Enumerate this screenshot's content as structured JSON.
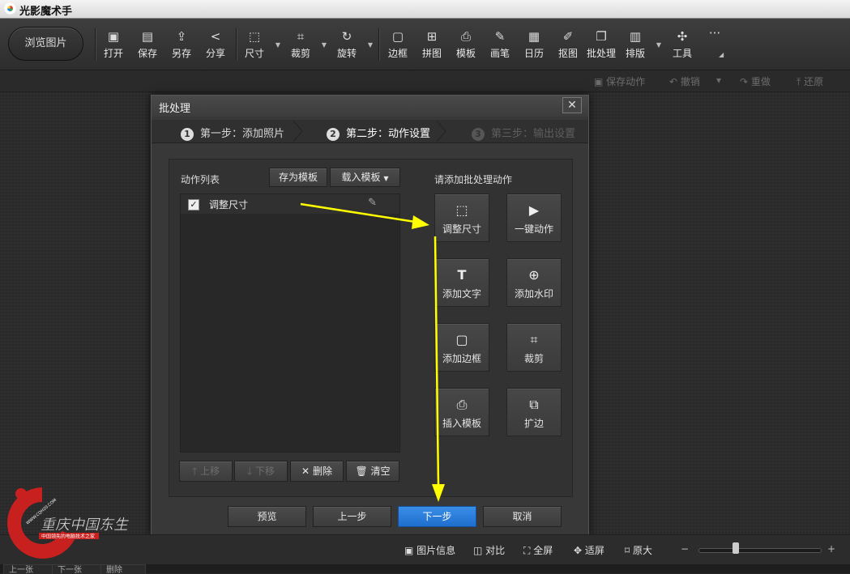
{
  "app": {
    "title": "光影魔术手"
  },
  "toolbar": {
    "browse_label": "浏览图片",
    "tools": [
      {
        "label": "打开",
        "icon": "open-image-icon"
      },
      {
        "label": "保存",
        "icon": "save-icon"
      },
      {
        "label": "另存",
        "icon": "save-as-icon"
      },
      {
        "label": "分享",
        "icon": "share-icon"
      },
      {
        "label": "尺寸",
        "icon": "resize-icon"
      },
      {
        "label": "裁剪",
        "icon": "crop-icon"
      },
      {
        "label": "旋转",
        "icon": "rotate-icon"
      },
      {
        "label": "边框",
        "icon": "border-icon"
      },
      {
        "label": "拼图",
        "icon": "collage-icon"
      },
      {
        "label": "模板",
        "icon": "template-icon"
      },
      {
        "label": "画笔",
        "icon": "brush-icon"
      },
      {
        "label": "日历",
        "icon": "calendar-icon"
      },
      {
        "label": "抠图",
        "icon": "cutout-icon"
      },
      {
        "label": "批处理",
        "icon": "batch-icon"
      },
      {
        "label": "排版",
        "icon": "layout-icon"
      },
      {
        "label": "工具",
        "icon": "wrench-icon"
      }
    ],
    "more": "···"
  },
  "actionbar": {
    "save_action": "保存动作",
    "undo": "撤销",
    "redo": "重做",
    "restore": "还原"
  },
  "dialog": {
    "title": "批处理",
    "close": "✕",
    "steps": [
      {
        "num": "1",
        "label": "第一步：添加照片"
      },
      {
        "num": "2",
        "label": "第二步：动作设置"
      },
      {
        "num": "3",
        "label": "第三步：输出设置"
      }
    ],
    "list_label": "动作列表",
    "save_template": "存为模板",
    "load_template": "载入模板",
    "actions": [
      {
        "name": "调整尺寸",
        "checked": true
      }
    ],
    "list_buttons": {
      "up": "上移",
      "down": "下移",
      "delete": "删除",
      "clear": "清空"
    },
    "add_label": "请添加批处理动作",
    "tiles": [
      {
        "label": "调整尺寸",
        "icon": "resize-icon"
      },
      {
        "label": "一键动作",
        "icon": "play-icon"
      },
      {
        "label": "添加文字",
        "icon": "add-text-icon"
      },
      {
        "label": "添加水印",
        "icon": "watermark-icon"
      },
      {
        "label": "添加边框",
        "icon": "add-border-icon"
      },
      {
        "label": "裁剪",
        "icon": "crop-icon"
      },
      {
        "label": "插入模板",
        "icon": "insert-template-icon"
      },
      {
        "label": "扩边",
        "icon": "expand-border-icon"
      }
    ],
    "footer": {
      "preview": "预览",
      "prev": "上一步",
      "next": "下一步",
      "cancel": "取消"
    }
  },
  "statusbar": {
    "info": "图片信息",
    "compare": "对比",
    "fullscreen": "全屏",
    "fit": "适屏",
    "original": "原大",
    "zoom_out": "−",
    "zoom_in": "+"
  },
  "bottombar": {
    "prev": "上一张",
    "next": "下一张",
    "delete": "删除"
  },
  "colors": {
    "accent": "#2a7fe0",
    "arrow": "#ffff00",
    "seal": "#c8201e"
  },
  "watermark": {
    "site": "WWW.CQH20.COM",
    "text": "重庆中国东生",
    "sub": "中国领先的电脑技术之家"
  }
}
